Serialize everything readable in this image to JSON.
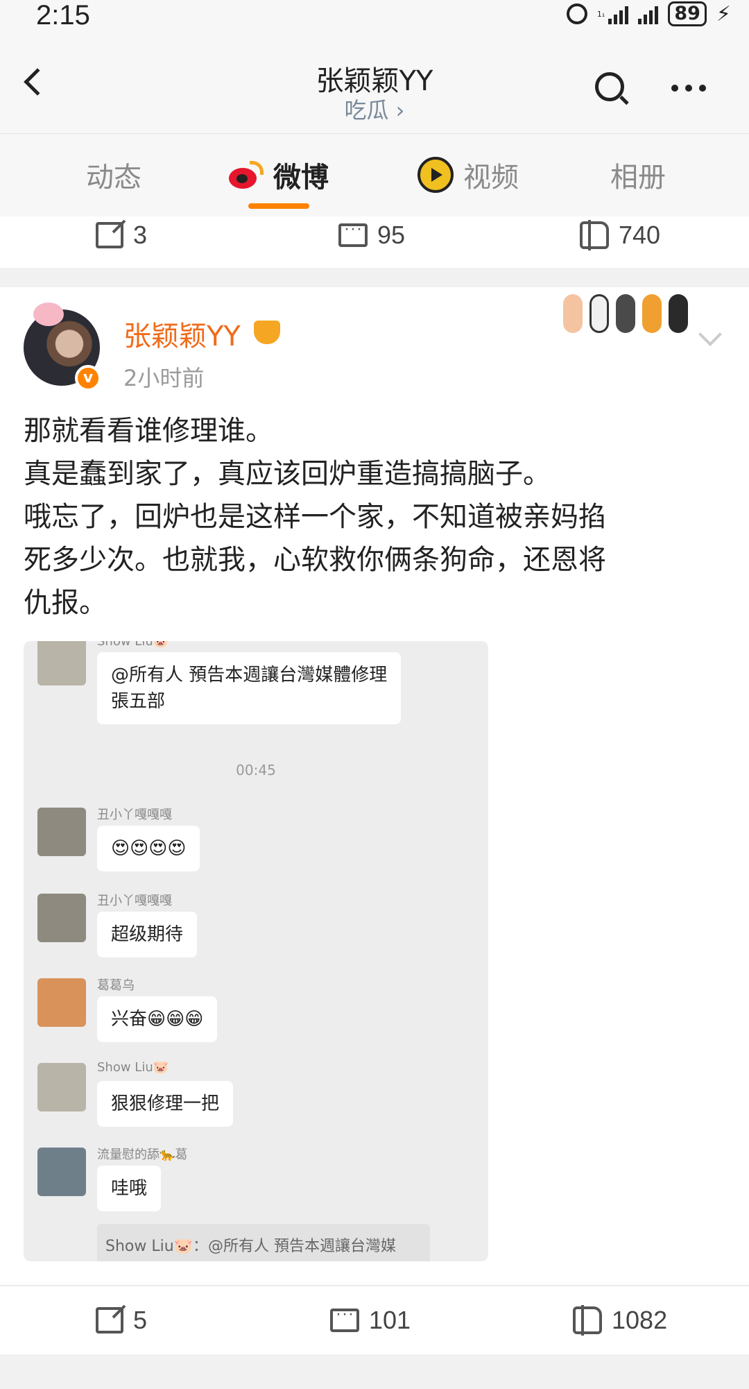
{
  "status_bar": {
    "time": "2:15",
    "network_label": "1₁",
    "battery": "89",
    "charging_symbol": "⚡"
  },
  "header": {
    "title": "张颖颖YY",
    "subtitle": "吃瓜 ›"
  },
  "tabs": [
    {
      "label": "动态"
    },
    {
      "label": "微博"
    },
    {
      "label": "视频"
    },
    {
      "label": "相册"
    }
  ],
  "accent_color": "#ff8200",
  "prev_post_actions": {
    "reposts": "3",
    "comments": "95",
    "likes": "740"
  },
  "post": {
    "author": "张颖颖YY",
    "time": "2小时前",
    "lines": [
      "那就看看谁修理谁。",
      "真是蠢到家了，真应该回炉重造搞搞脑子。",
      "哦忘了，回炉也是这样一个家，不知道被亲妈掐",
      "死多少次。也就我，心软救你俩条狗命，还恩将",
      "仇报。"
    ],
    "image": {
      "top_sender": "Show Liu🐷",
      "first_message": [
        "@所有人  預告本週讓台灣媒體修理",
        "張五部"
      ],
      "timestamp": "00:45",
      "messages": [
        {
          "sender": "丑小丫嘎嘎嘎",
          "text": "😍😍😍😍"
        },
        {
          "sender": "丑小丫嘎嘎嘎",
          "text": "超级期待"
        },
        {
          "sender": "葛葛乌",
          "text": "兴奋😁😁😁"
        },
        {
          "sender": "Show Liu🐷",
          "text": "狠狠修理一把"
        },
        {
          "sender": "流量慰的舔🐆葛",
          "text": "哇哦"
        }
      ],
      "quote": "Show Liu🐷：@所有人 預告本週讓台灣媒"
    },
    "actions": {
      "reposts": "5",
      "comments": "101",
      "likes": "1082"
    }
  }
}
